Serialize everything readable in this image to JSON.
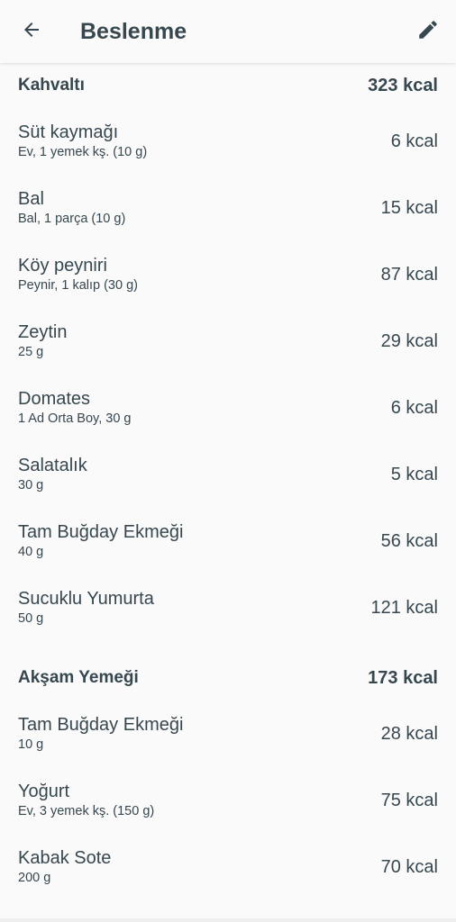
{
  "appbar": {
    "title": "Beslenme",
    "back_icon": "arrow-left-icon",
    "edit_icon": "pencil-icon"
  },
  "meals": [
    {
      "name": "Kahvaltı",
      "kcal": "323 kcal",
      "items": [
        {
          "name": "Süt kaymağı",
          "detail": "Ev, 1 yemek kş. (10 g)",
          "kcal": "6 kcal"
        },
        {
          "name": "Bal",
          "detail": "Bal, 1 parça (10 g)",
          "kcal": "15 kcal"
        },
        {
          "name": "Köy peyniri",
          "detail": "Peynir, 1 kalıp (30 g)",
          "kcal": "87 kcal"
        },
        {
          "name": "Zeytin",
          "detail": "25 g",
          "kcal": "29 kcal"
        },
        {
          "name": "Domates",
          "detail": "1 Ad Orta Boy, 30 g",
          "kcal": "6 kcal"
        },
        {
          "name": "Salatalık",
          "detail": "30 g",
          "kcal": "5 kcal"
        },
        {
          "name": "Tam Buğday Ekmeği",
          "detail": "40 g",
          "kcal": "56 kcal"
        },
        {
          "name": "Sucuklu Yumurta",
          "detail": "50 g",
          "kcal": "121 kcal"
        }
      ]
    },
    {
      "name": "Akşam Yemeği",
      "kcal": "173 kcal",
      "items": [
        {
          "name": "Tam Buğday Ekmeği",
          "detail": "10 g",
          "kcal": "28 kcal"
        },
        {
          "name": "Yoğurt",
          "detail": "Ev, 3 yemek kş. (150 g)",
          "kcal": "75 kcal"
        },
        {
          "name": "Kabak Sote",
          "detail": "200 g",
          "kcal": "70 kcal"
        }
      ]
    }
  ],
  "colors": {
    "background": "#fafafa",
    "text": "#37474f"
  }
}
